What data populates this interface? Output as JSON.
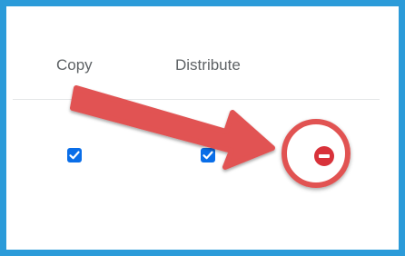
{
  "table": {
    "columns": [
      {
        "label": "Copy"
      },
      {
        "label": "Distribute"
      }
    ],
    "row": {
      "copy_checked": true,
      "distribute_checked": true
    }
  },
  "icons": {
    "checkbox": "checkmark-icon",
    "remove": "minus-circle-icon",
    "annotation_arrow": "arrow-annotation",
    "annotation_ring": "circle-highlight"
  },
  "colors": {
    "frame_border": "#2b9bd9",
    "checkbox_fill": "#0a6ee8",
    "remove_fill": "#d8323a",
    "annotation": "#e15352",
    "header_text": "#5e6265"
  }
}
